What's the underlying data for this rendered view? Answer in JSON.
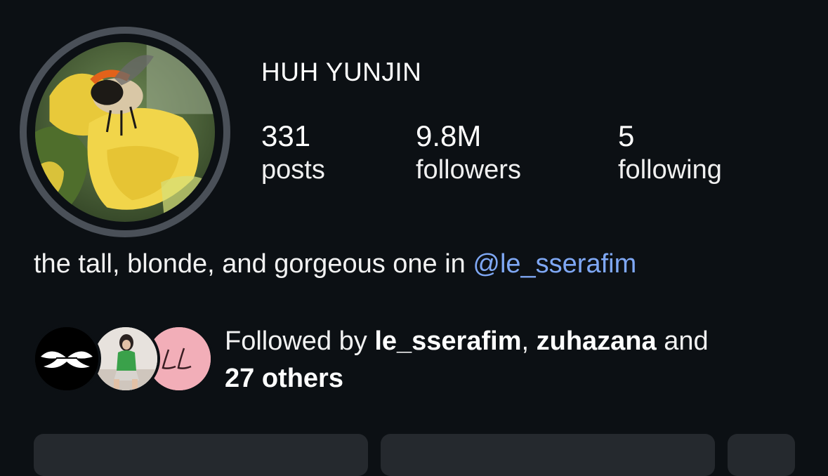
{
  "profile": {
    "username": "HUH YUNJIN",
    "avatar_icon": "bumblebee-on-yellow-flower-photo",
    "stats": {
      "posts": {
        "value": "331",
        "label": "posts"
      },
      "followers": {
        "value": "9.8M",
        "label": "followers"
      },
      "following": {
        "value": "5",
        "label": "following"
      }
    },
    "bio": {
      "text": "the tall, blonde, and gorgeous one in ",
      "mention": "@le_sserafim"
    },
    "followed_by": {
      "prefix": "Followed by ",
      "user1": "le_sserafim",
      "sep": ", ",
      "user2": "zuhazana",
      "and": " and",
      "others": "27 others",
      "avatars": [
        "le-sserafim-logo-avatar",
        "zuhazana-photo-avatar",
        "ll-monogram-avatar"
      ]
    }
  },
  "colors": {
    "background": "#0c1014",
    "mention": "#7fa8f5",
    "avatar_ring": "#4a5058",
    "button": "#25292e"
  }
}
